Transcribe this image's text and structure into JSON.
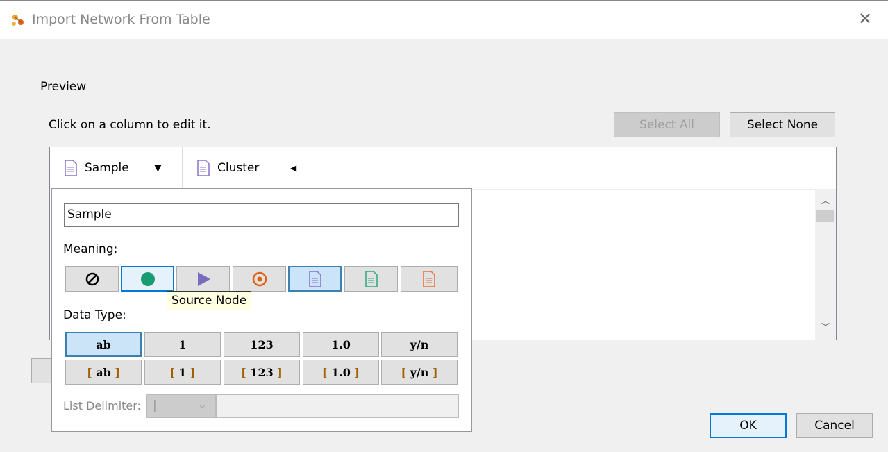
{
  "window": {
    "title": "Import Network From Table",
    "close": "✕"
  },
  "preview": {
    "legend": "Preview",
    "hint": "Click on a column to edit it.",
    "select_all": "Select All",
    "select_none": "Select None"
  },
  "columns": [
    {
      "name": "Sample",
      "arrow": "▼"
    },
    {
      "name": "Cluster",
      "arrow": "◀"
    }
  ],
  "editor": {
    "name_value": "Sample",
    "meaning_label": "Meaning:",
    "tooltip": "Source Node",
    "data_type_label": "Data Type:",
    "types": [
      "ab",
      "1",
      "123",
      "1.0",
      "y/n"
    ],
    "list_types": [
      "ab",
      "1",
      "123",
      "1.0",
      "y/n"
    ],
    "list_delimiter_label": "List Delimiter:",
    "list_delimiter_value": "|"
  },
  "meanings": [
    {
      "name": "not-imported",
      "color": "#000000"
    },
    {
      "name": "source-node",
      "color": "#1a9c73"
    },
    {
      "name": "interaction",
      "color": "#7b6bc0"
    },
    {
      "name": "target-node",
      "color": "#e06010"
    },
    {
      "name": "edge-attribute",
      "color": "#8a70c8"
    },
    {
      "name": "source-node-attribute",
      "color": "#2aa880"
    },
    {
      "name": "target-node-attribute",
      "color": "#e87030"
    }
  ],
  "footer": {
    "ok": "OK",
    "cancel": "Cancel"
  }
}
